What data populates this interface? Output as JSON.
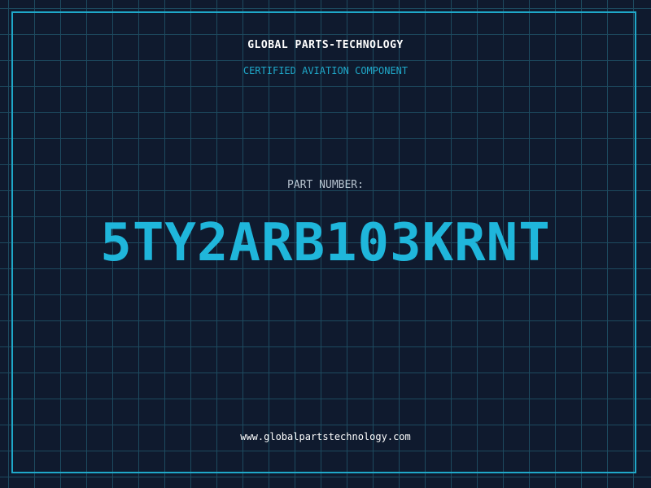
{
  "header": {
    "company_name": "GLOBAL PARTS-TECHNOLOGY",
    "subtitle": "CERTIFIED AVIATION COMPONENT"
  },
  "part": {
    "label": "PART NUMBER:",
    "number": "5TY2ARB103KRNT"
  },
  "footer": {
    "website": "www.globalpartstechnology.com"
  },
  "colors": {
    "background": "#0f1a2e",
    "grid": "#1d4a5f",
    "accent": "#1fb6db",
    "text": "#ffffff"
  }
}
